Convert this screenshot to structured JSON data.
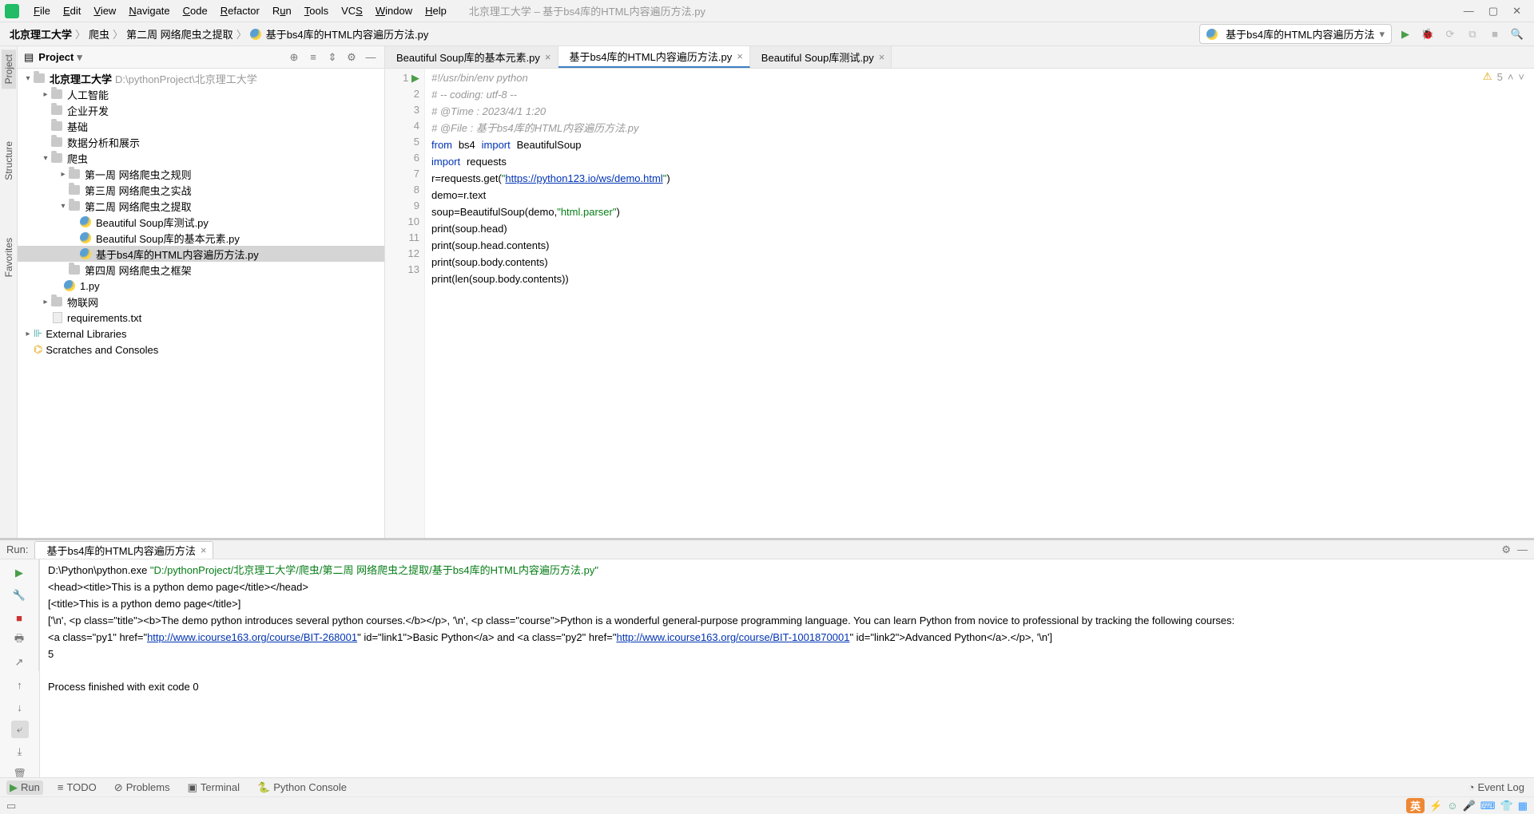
{
  "window": {
    "title": "北京理工大学 – 基于bs4库的HTML内容遍历方法.py"
  },
  "menu": [
    "File",
    "Edit",
    "View",
    "Navigate",
    "Code",
    "Refactor",
    "Run",
    "Tools",
    "VCS",
    "Window",
    "Help"
  ],
  "breadcrumb": {
    "root": "北京理工大学",
    "p1": "爬虫",
    "p2": "第二周 网络爬虫之提取",
    "file": "基于bs4库的HTML内容遍历方法.py"
  },
  "runcfg": {
    "name": "基于bs4库的HTML内容遍历方法"
  },
  "project": {
    "header": "Project",
    "root": {
      "name": "北京理工大学",
      "path": "D:\\pythonProject\\北京理工大学"
    },
    "nodes": {
      "n1": "人工智能",
      "n2": "企业开发",
      "n3": "基础",
      "n4": "数据分析和展示",
      "n5": "爬虫",
      "n51": "第一周 网络爬虫之规则",
      "n52": "第三周 网络爬虫之实战",
      "n53": "第二周 网络爬虫之提取",
      "n531": "Beautiful Soup库测试.py",
      "n532": "Beautiful  Soup库的基本元素.py",
      "n533": "基于bs4库的HTML内容遍历方法.py",
      "n54": "第四周 网络爬虫之框架",
      "n55": "1.py",
      "n6": "物联网",
      "n7": "requirements.txt",
      "ext": "External Libraries",
      "scratch": "Scratches and Consoles"
    }
  },
  "tabs": [
    {
      "label": "Beautiful  Soup库的基本元素.py"
    },
    {
      "label": "基于bs4库的HTML内容遍历方法.py"
    },
    {
      "label": "Beautiful Soup库测试.py"
    }
  ],
  "editor_status": {
    "warnings": "5"
  },
  "code": {
    "l1": "#!/usr/bin/env python",
    "l2": "# -- coding: utf-8 --",
    "l3": "# @Time : 2023/4/1 1:20",
    "l4": "# @File : 基于bs4库的HTML内容遍历方法.py",
    "l5a": "from",
    "l5b": "bs4",
    "l5c": "import",
    "l5d": "BeautifulSoup",
    "l6a": "import",
    "l6b": "requests",
    "l7a": "r=requests.get(",
    "l7b": "\"",
    "l7c": "https://python123.io/ws/demo.html",
    "l7d": "\"",
    "l7e": ")",
    "l8": "demo=r.text",
    "l9a": "soup=BeautifulSoup(demo,",
    "l9b": "\"html.parser\"",
    "l9c": ")",
    "l10": "print(soup.head)",
    "l11": "print(soup.head.contents)",
    "l12": "print(soup.body.contents)",
    "l13": "print(len(soup.body.contents))"
  },
  "run": {
    "label": "Run:",
    "tab": "基于bs4库的HTML内容遍历方法",
    "out": {
      "cmd_a": "D:\\Python\\python.exe ",
      "cmd_b": "\"D:/pythonProject/北京理工大学/爬虫/第二周 网络爬虫之提取/基于bs4库的HTML内容遍历方法.py\"",
      "l2": "<head><title>This is a python demo page</title></head>",
      "l3": "[<title>This is a python demo page</title>]",
      "l4a": "['\\n', <p class=\"title\"><b>The demo python introduces several python courses.</b></p>, '\\n', <p class=\"course\">Python is a wonderful general-purpose programming language. You can learn Python from novice to professional by tracking the following courses:",
      "l5a": "<a class=\"py1\" href=\"",
      "l5link1": "http://www.icourse163.org/course/BIT-268001",
      "l5b": "\" id=\"link1\">Basic Python</a> and <a class=\"py2\" href=\"",
      "l5link2": "http://www.icourse163.org/course/BIT-1001870001",
      "l5c": "\" id=\"link2\">Advanced Python</a>.</p>, '\\n']",
      "l6": "5",
      "l8": "Process finished with exit code 0"
    }
  },
  "bottom": {
    "run": "Run",
    "todo": "TODO",
    "problems": "Problems",
    "terminal": "Terminal",
    "pyconsole": "Python Console",
    "eventlog": "Event Log"
  },
  "ime": {
    "label": "英"
  },
  "leftstrip": {
    "project": "Project",
    "structure": "Structure",
    "favorites": "Favorites"
  }
}
